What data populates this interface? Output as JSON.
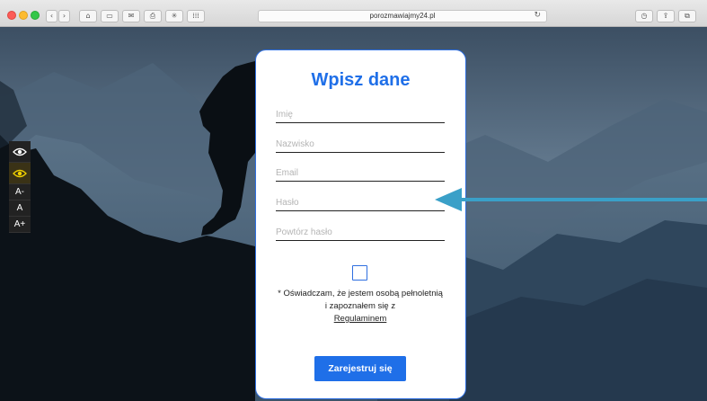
{
  "browser": {
    "url": "porozmawiajmy24.pl",
    "icons": [
      "back-icon",
      "forward-icon",
      "home-icon",
      "sidebar-icon",
      "mail-icon",
      "print-icon",
      "extension-icon",
      "grid-icon",
      "reload-icon",
      "history-icon",
      "share-icon",
      "tabs-icon"
    ]
  },
  "accessibility": {
    "contrast_icon": "eye-icon",
    "yellow_contrast_icon": "eye-yellow-icon",
    "font_decrease": "A-",
    "font_reset": "A",
    "font_increase": "A+"
  },
  "form": {
    "title": "Wpisz dane",
    "fields": {
      "first_name_placeholder": "Imię",
      "last_name_placeholder": "Nazwisko",
      "email_placeholder": "Email",
      "password_placeholder": "Hasło",
      "password_repeat_placeholder": "Powtórz hasło"
    },
    "consent_text": "* Oświadczam, że jestem osobą pełnoletnią i zapoznałem się z",
    "consent_link": "Regulaminem",
    "submit_label": "Zarejestruj się"
  },
  "colors": {
    "accent": "#1f6fe8",
    "arrow": "#3aa0c8",
    "a11y_bg": "#222222",
    "a11y_yellow": "#f2d200"
  }
}
